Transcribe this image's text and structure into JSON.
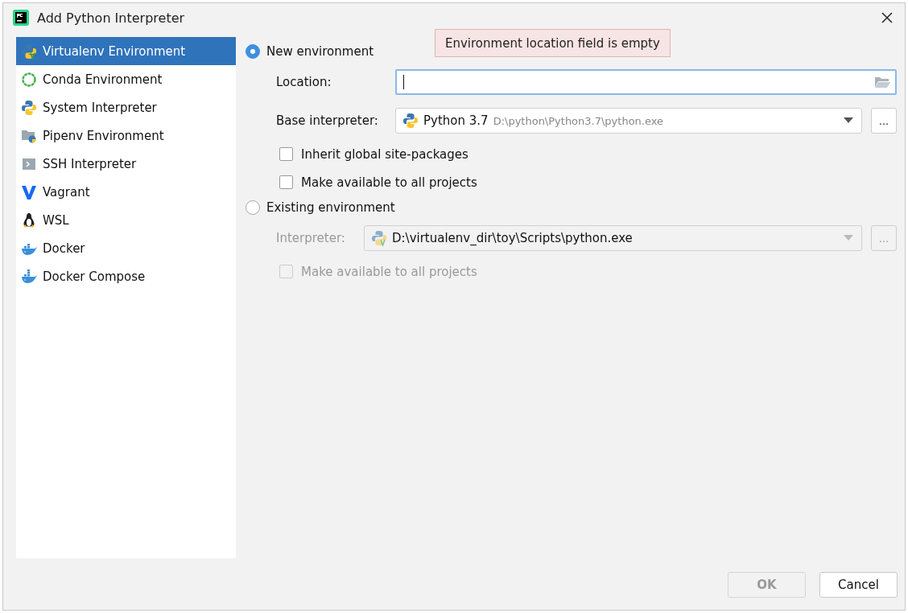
{
  "window": {
    "title": "Add Python Interpreter"
  },
  "sidebar": {
    "items": [
      {
        "label": "Virtualenv Environment",
        "kind": "virtualenv",
        "selected": true
      },
      {
        "label": "Conda Environment",
        "kind": "conda",
        "selected": false
      },
      {
        "label": "System Interpreter",
        "kind": "python",
        "selected": false
      },
      {
        "label": "Pipenv Environment",
        "kind": "pipenv",
        "selected": false
      },
      {
        "label": "SSH Interpreter",
        "kind": "ssh",
        "selected": false
      },
      {
        "label": "Vagrant",
        "kind": "vagrant",
        "selected": false
      },
      {
        "label": "WSL",
        "kind": "wsl",
        "selected": false
      },
      {
        "label": "Docker",
        "kind": "docker",
        "selected": false
      },
      {
        "label": "Docker Compose",
        "kind": "compose",
        "selected": false
      }
    ]
  },
  "new_environment": {
    "label": "New environment",
    "selected": true,
    "error": "Environment location field is empty",
    "location": {
      "label": "Location:",
      "focused": true
    },
    "base_interpreter": {
      "label": "Base interpreter:",
      "name": "Python 3.7",
      "path": "D:\\python\\Python3.7\\python.exe",
      "browse": "..."
    },
    "checkboxes": [
      {
        "label": "Inherit global site-packages",
        "checked": false
      },
      {
        "label": "Make available to all projects",
        "checked": false
      }
    ]
  },
  "existing_environment": {
    "label": "Existing environment",
    "selected": false,
    "disabled": true,
    "interpreter": {
      "label": "Interpreter:",
      "value": "D:\\virtualenv_dir\\toy\\Scripts\\python.exe",
      "browse": "..."
    },
    "checkboxes": [
      {
        "label": "Make available to all projects",
        "checked": false
      }
    ]
  },
  "buttons": [
    {
      "label": "OK",
      "disabled": true
    },
    {
      "label": "Cancel",
      "disabled": false
    }
  ]
}
